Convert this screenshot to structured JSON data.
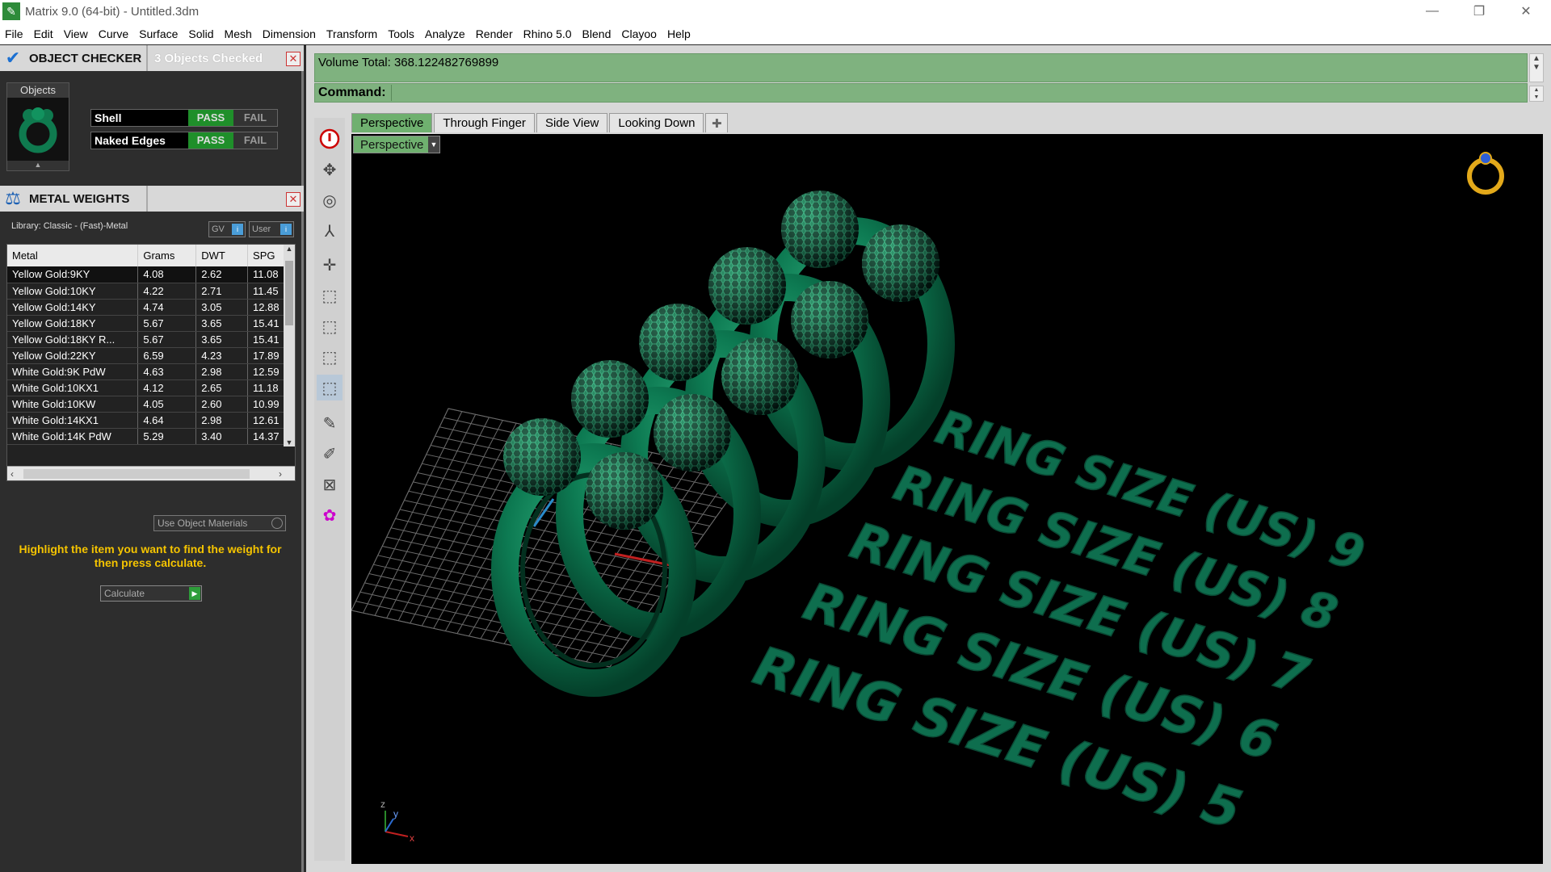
{
  "window": {
    "title": "Matrix 9.0 (64-bit) - Untitled.3dm",
    "minimize_icon": "minimize-icon",
    "maximize_icon": "restore-icon",
    "close_icon": "close-icon"
  },
  "menu": [
    "File",
    "Edit",
    "View",
    "Curve",
    "Surface",
    "Solid",
    "Mesh",
    "Dimension",
    "Transform",
    "Tools",
    "Analyze",
    "Render",
    "Rhino 5.0",
    "Blend",
    "Clayoo",
    "Help"
  ],
  "object_checker": {
    "title": "OBJECT CHECKER",
    "info": "3  Objects Checked",
    "objects_label": "Objects",
    "checks": [
      {
        "label": "Shell",
        "pass": "PASS",
        "fail": "FAIL"
      },
      {
        "label": "Naked Edges",
        "pass": "PASS",
        "fail": "FAIL"
      }
    ]
  },
  "metal_weights": {
    "title": "METAL WEIGHTS",
    "library": "Library: Classic - (Fast)-Metal",
    "gv_label": "GV",
    "user_label": "User",
    "columns": [
      "Metal",
      "Grams",
      "DWT",
      "SPG"
    ],
    "rows": [
      [
        "Yellow Gold:9KY",
        "4.08",
        "2.62",
        "11.08"
      ],
      [
        "Yellow Gold:10KY",
        "4.22",
        "2.71",
        "11.45"
      ],
      [
        "Yellow Gold:14KY",
        "4.74",
        "3.05",
        "12.88"
      ],
      [
        "Yellow Gold:18KY",
        "5.67",
        "3.65",
        "15.41"
      ],
      [
        "Yellow Gold:18KY R...",
        "5.67",
        "3.65",
        "15.41"
      ],
      [
        "Yellow Gold:22KY",
        "6.59",
        "4.23",
        "17.89"
      ],
      [
        "White Gold:9K PdW",
        "4.63",
        "2.98",
        "12.59"
      ],
      [
        "White Gold:10KX1",
        "4.12",
        "2.65",
        "11.18"
      ],
      [
        "White Gold:10KW",
        "4.05",
        "2.60",
        "10.99"
      ],
      [
        "White Gold:14KX1",
        "4.64",
        "2.98",
        "12.61"
      ],
      [
        "White Gold:14K PdW",
        "5.29",
        "3.40",
        "14.37"
      ]
    ],
    "use_materials": "Use Object Materials",
    "hint": "Highlight the item you want to find the weight for then press calculate.",
    "calculate": "Calculate"
  },
  "command_area": {
    "history": "Volume Total: 368.122482769899",
    "command_label": "Command:",
    "command_value": ""
  },
  "viewport": {
    "tabs": [
      "Perspective",
      "Through Finger",
      "Side View",
      "Looking Down"
    ],
    "active_tab": "Perspective",
    "view_name": "Perspective",
    "ring_sizes": [
      "RING SIZE (US)   9",
      "RING SIZE (US)   8",
      "RING SIZE (US)   7",
      "RING SIZE (US)   6",
      "RING SIZE (US)   5"
    ],
    "axis_labels": {
      "x": "x",
      "y": "y",
      "z": "z"
    }
  },
  "toolbar_icons": [
    "stop-icon",
    "gumball-icon",
    "globe-icon",
    "axis-icon",
    "transform-icon",
    "cube-top-icon",
    "cube-front-icon",
    "cube-side-icon",
    "cube-persp-icon",
    "dropper-icon",
    "brush-icon",
    "zoom-extents-icon",
    "gear-color-icon"
  ],
  "colors": {
    "accent_green": "#6fb06f",
    "pass_green": "#1f8f2a",
    "model_green": "#0e6e4e",
    "hint_yellow": "#f5c400"
  }
}
